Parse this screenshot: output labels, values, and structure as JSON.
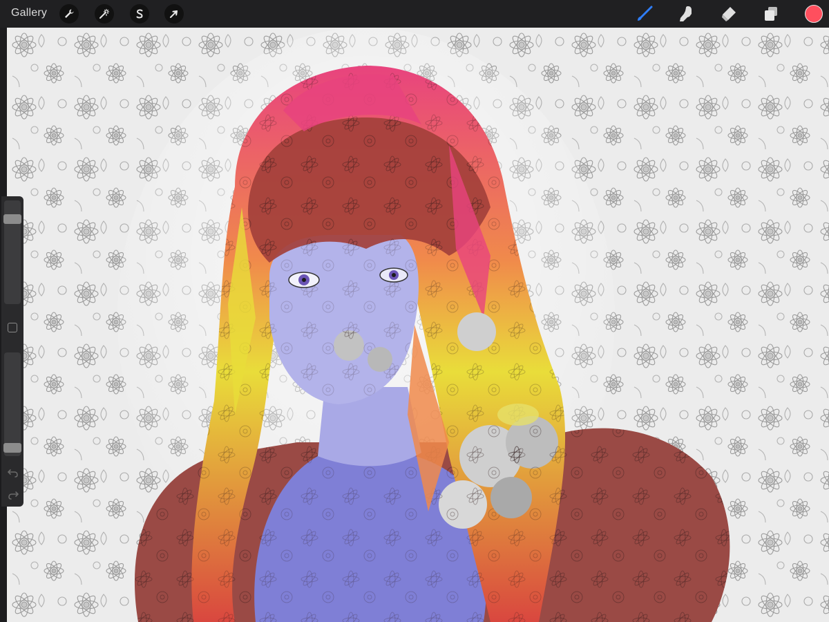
{
  "app": {
    "gallery_label": "Gallery"
  },
  "toolbar": {
    "left_tools": [
      {
        "name": "actions",
        "icon": "wrench-icon"
      },
      {
        "name": "adjustments",
        "icon": "magic-wand-icon"
      },
      {
        "name": "selection",
        "icon": "selection-s-icon"
      },
      {
        "name": "transform",
        "icon": "arrow-cursor-icon"
      }
    ],
    "right_tools": [
      {
        "name": "brush",
        "icon": "brush-icon",
        "active": true
      },
      {
        "name": "smudge",
        "icon": "smudge-finger-icon",
        "active": false
      },
      {
        "name": "eraser",
        "icon": "eraser-icon",
        "active": false
      },
      {
        "name": "layers",
        "icon": "layers-icon",
        "active": false
      }
    ],
    "active_color": "#ff4f5e",
    "accent": "#2f7df6"
  },
  "sidebar": {
    "brush_size_level": 0.15,
    "opacity_level": 0.96,
    "undo_icon": "undo-arrow-icon",
    "redo_icon": "redo-arrow-icon",
    "modify_icon": "square-modify-icon"
  },
  "artwork": {
    "palette": {
      "background": "#ececec",
      "hair_pink": "#e8437e",
      "hair_orange": "#f08a4b",
      "hair_yellow": "#e9dd3a",
      "hair_red": "#a3403b",
      "skin_lavender": "#b3b3ea",
      "body_periwinkle": "#7f7fd6",
      "cloak_red": "#9a4a45",
      "flowers_grey": "#8a8a8a"
    }
  }
}
